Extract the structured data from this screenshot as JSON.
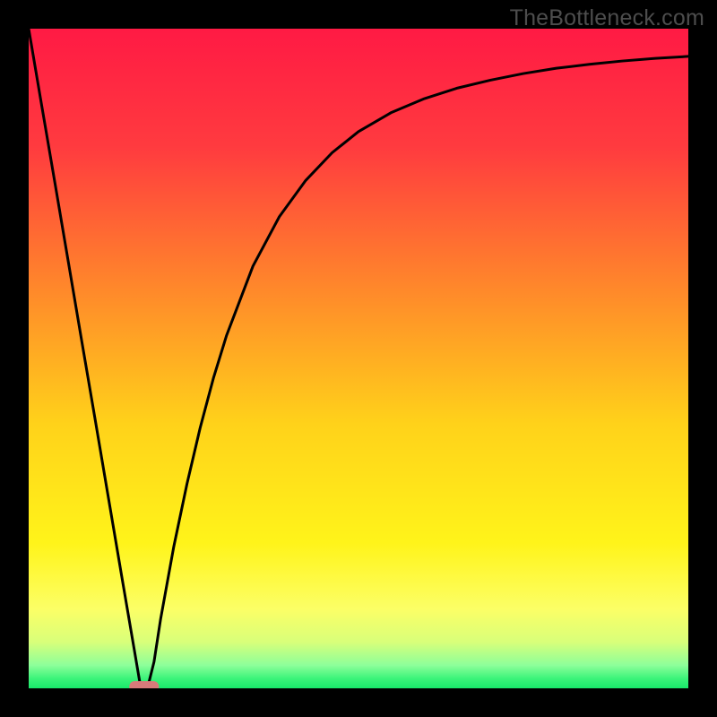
{
  "watermark": "TheBottleneck.com",
  "chart_data": {
    "type": "line",
    "title": "",
    "xlabel": "",
    "ylabel": "",
    "xlim": [
      0,
      100
    ],
    "ylim": [
      0,
      100
    ],
    "legend": false,
    "grid": false,
    "x": [
      0,
      2,
      4,
      6,
      8,
      10,
      12,
      14,
      16,
      17,
      18,
      19,
      20,
      22,
      24,
      26,
      28,
      30,
      34,
      38,
      42,
      46,
      50,
      55,
      60,
      65,
      70,
      75,
      80,
      85,
      90,
      95,
      100
    ],
    "values": [
      100,
      88.2,
      76.5,
      64.7,
      52.9,
      41.2,
      29.4,
      17.6,
      5.9,
      0,
      0,
      4.0,
      10.5,
      21.5,
      31.0,
      39.5,
      47.0,
      53.5,
      64.0,
      71.5,
      77.0,
      81.2,
      84.4,
      87.3,
      89.4,
      91.0,
      92.2,
      93.2,
      94.0,
      94.6,
      95.1,
      95.5,
      95.8
    ],
    "marker": {
      "shape": "pill",
      "x_center": 17.5,
      "y": 0,
      "width_x_units": 4.5,
      "color": "#d77a7a"
    },
    "background_gradient": {
      "stops": [
        {
          "offset": 0.0,
          "color": "#ff1a44"
        },
        {
          "offset": 0.18,
          "color": "#ff3b3f"
        },
        {
          "offset": 0.4,
          "color": "#ff8a2a"
        },
        {
          "offset": 0.6,
          "color": "#ffd21a"
        },
        {
          "offset": 0.78,
          "color": "#fff41a"
        },
        {
          "offset": 0.88,
          "color": "#fcff66"
        },
        {
          "offset": 0.93,
          "color": "#d8ff7a"
        },
        {
          "offset": 0.965,
          "color": "#8dff9a"
        },
        {
          "offset": 0.985,
          "color": "#3cf47a"
        },
        {
          "offset": 1.0,
          "color": "#18e86a"
        }
      ]
    }
  }
}
